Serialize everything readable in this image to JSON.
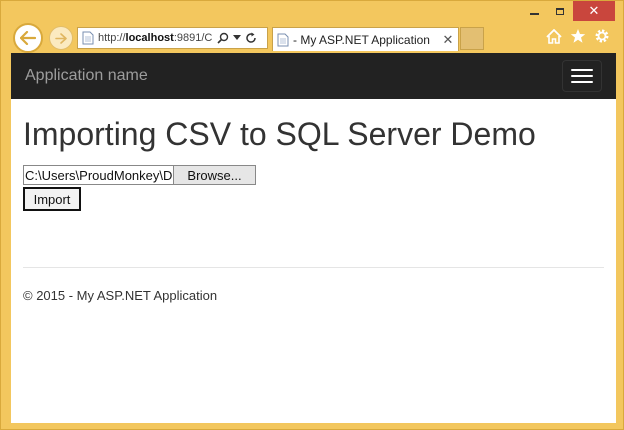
{
  "browser": {
    "url_prefix": "http://",
    "url_host": "localhost",
    "url_rest": ":9891/C",
    "tab_title": "- My ASP.NET Application",
    "tab_close": "✕",
    "window_close": "✕"
  },
  "navbar": {
    "brand": "Application name"
  },
  "main": {
    "title": "Importing CSV to SQL Server Demo",
    "file_path_value": "C:\\Users\\ProudMonkey\\D",
    "browse_label": "Browse...",
    "import_label": "Import"
  },
  "footer": {
    "text": "© 2015 - My ASP.NET Application"
  },
  "colors": {
    "frame": "#f3c75e",
    "navbar": "#222222",
    "close_button": "#c9463d"
  }
}
